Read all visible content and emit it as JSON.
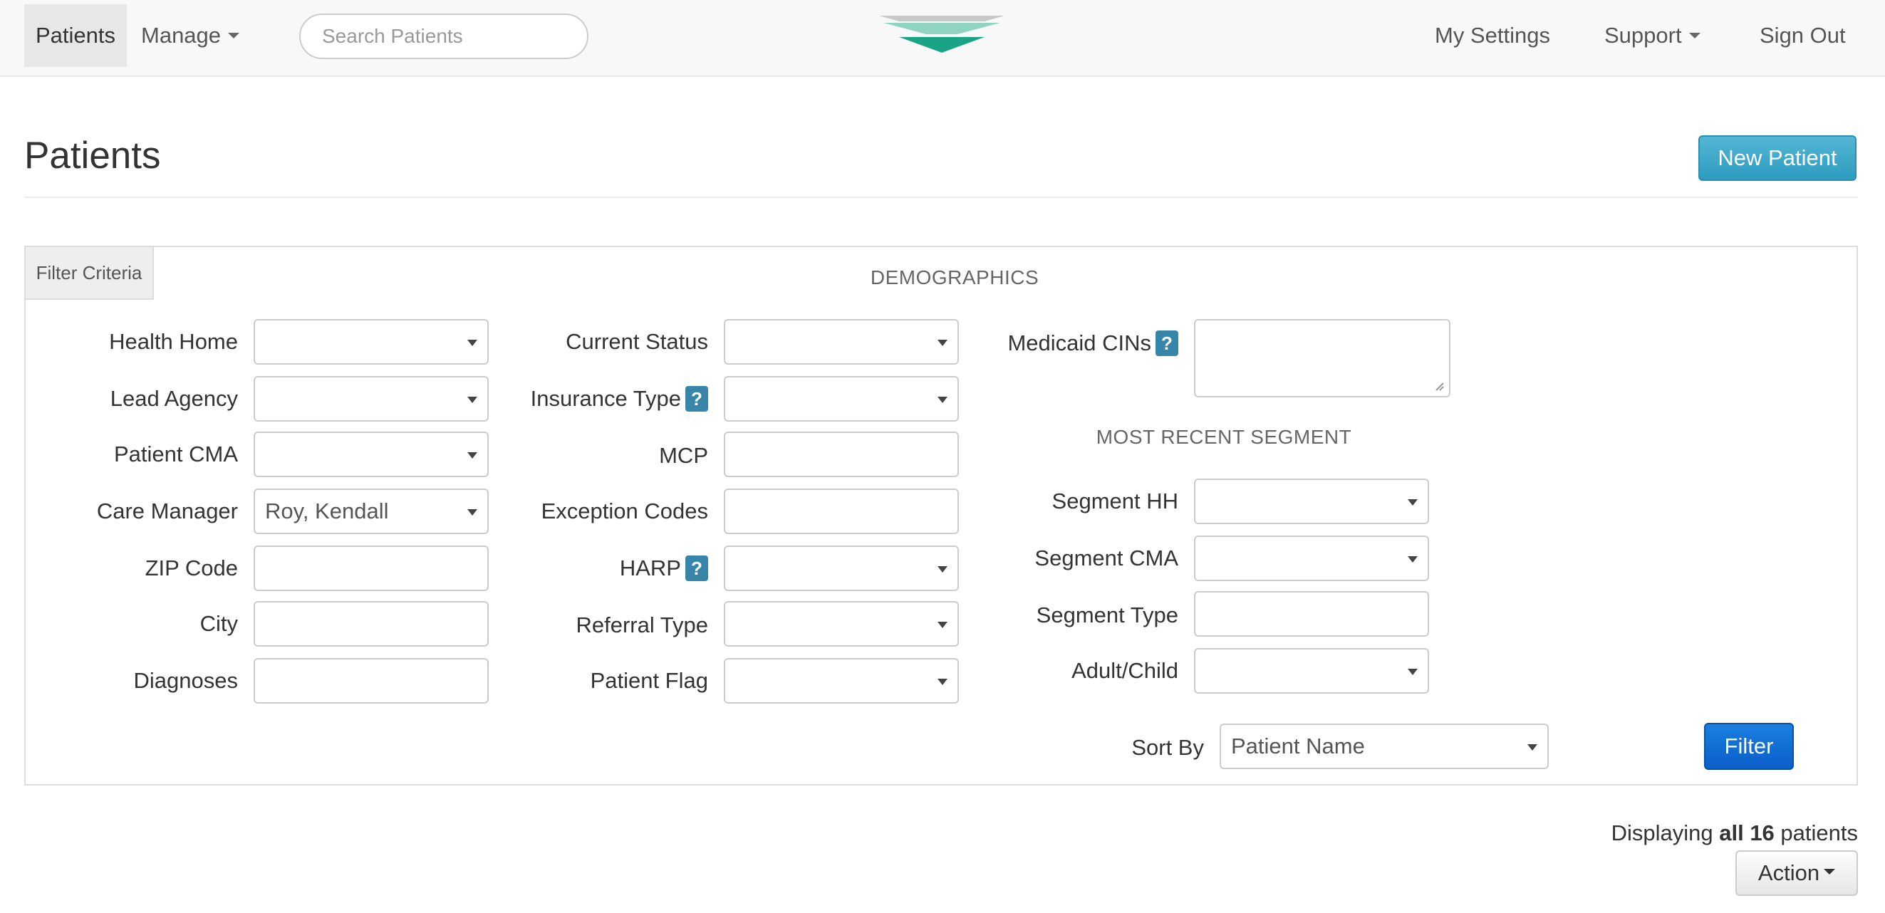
{
  "nav": {
    "patients": "Patients",
    "manage": "Manage",
    "search_placeholder": "Search Patients",
    "my_settings": "My Settings",
    "support": "Support",
    "sign_out": "Sign Out"
  },
  "page": {
    "title": "Patients",
    "new_patient": "New Patient"
  },
  "filter": {
    "tab": "Filter Criteria",
    "demographics": "DEMOGRAPHICS",
    "most_recent_segment": "MOST RECENT SEGMENT",
    "col1": [
      {
        "label": "Health Home",
        "value": "",
        "type": "select"
      },
      {
        "label": "Lead Agency",
        "value": "",
        "type": "select"
      },
      {
        "label": "Patient CMA",
        "value": "",
        "type": "select"
      },
      {
        "label": "Care Manager",
        "value": "Roy, Kendall",
        "type": "select"
      },
      {
        "label": "ZIP Code",
        "value": "",
        "type": "text"
      },
      {
        "label": "City",
        "value": "",
        "type": "text"
      },
      {
        "label": "Diagnoses",
        "value": "",
        "type": "text"
      }
    ],
    "col2": [
      {
        "label": "Current Status",
        "value": "",
        "type": "select"
      },
      {
        "label": "Insurance Type",
        "value": "",
        "type": "select",
        "help": "?"
      },
      {
        "label": "MCP",
        "value": "",
        "type": "text"
      },
      {
        "label": "Exception Codes",
        "value": "",
        "type": "text"
      },
      {
        "label": "HARP",
        "value": "",
        "type": "select",
        "help": "?"
      },
      {
        "label": "Referral Type",
        "value": "",
        "type": "select"
      },
      {
        "label": "Patient Flag",
        "value": "",
        "type": "select"
      }
    ],
    "medicaid_cins": {
      "label": "Medicaid CINs",
      "help": "?",
      "value": ""
    },
    "segment": [
      {
        "label": "Segment HH",
        "value": "",
        "type": "select"
      },
      {
        "label": "Segment CMA",
        "value": "",
        "type": "select"
      },
      {
        "label": "Segment Type",
        "value": "",
        "type": "text"
      },
      {
        "label": "Adult/Child",
        "value": "",
        "type": "select"
      }
    ],
    "sort_by": {
      "label": "Sort By",
      "value": "Patient Name"
    },
    "filter_button": "Filter"
  },
  "results": {
    "prefix": "Displaying ",
    "bold": "all 16",
    "suffix": " patients",
    "action": "Action"
  },
  "colors": {
    "new_patient_button": "#31a0c6",
    "filter_button": "#0c66d0",
    "help_badge": "#3786aa"
  }
}
